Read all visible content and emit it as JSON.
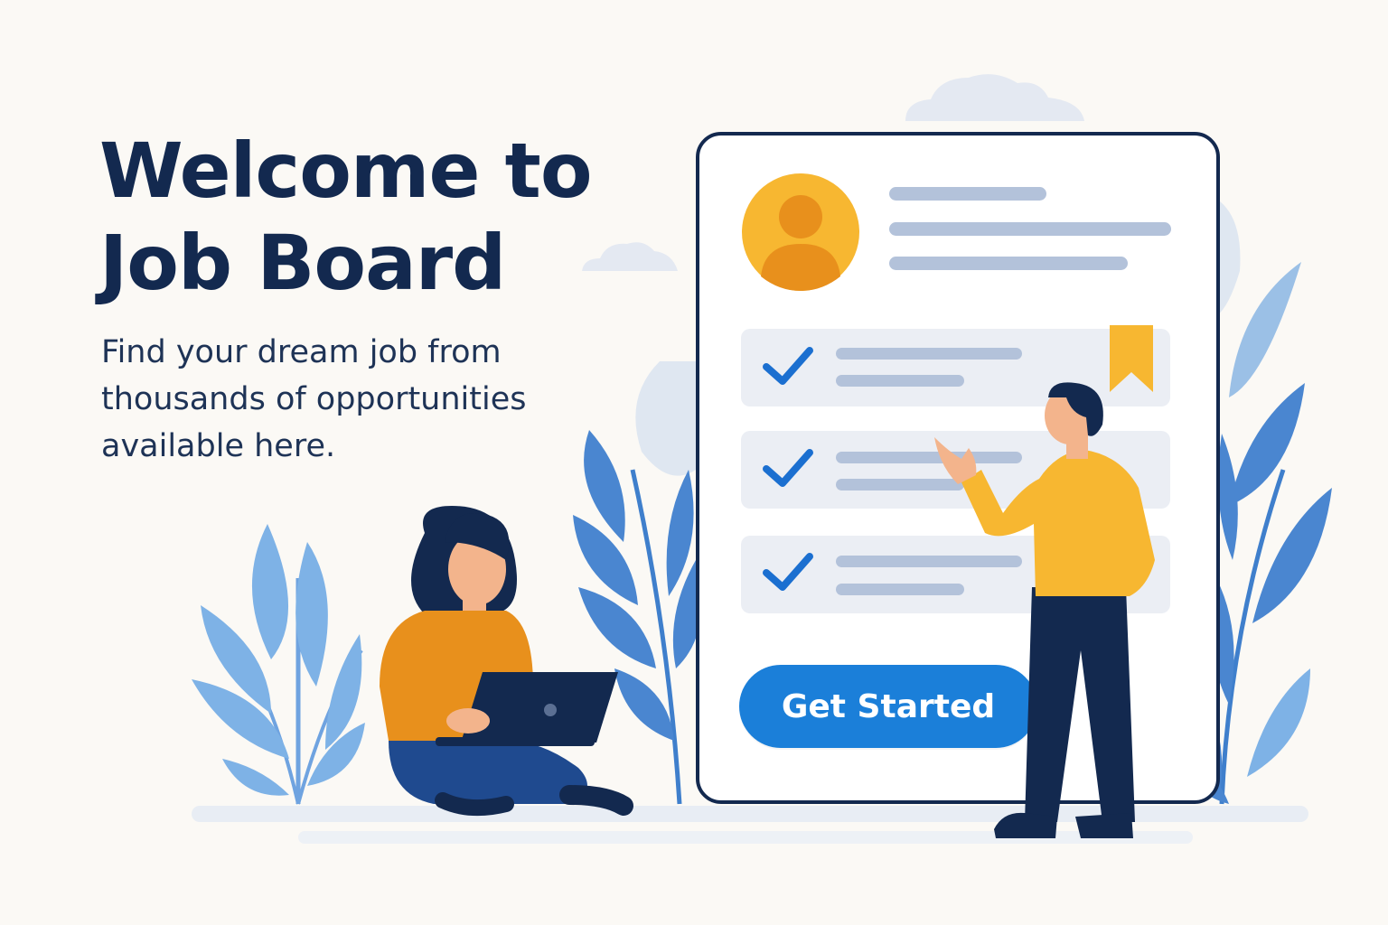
{
  "hero": {
    "title_line1": "Welcome to",
    "title_line2": "Job Board",
    "subtitle_line1": "Find your dream job from",
    "subtitle_line2": "thousands of opportunities",
    "subtitle_line3": "available here."
  },
  "card": {
    "cta_label": "Get Started",
    "job_items": [
      {
        "status": "checked"
      },
      {
        "status": "checked"
      },
      {
        "status": "checked"
      }
    ]
  },
  "icons": [
    "cloud-icon",
    "user-avatar-icon",
    "bookmark-icon",
    "checkmark-icon",
    "laptop-icon",
    "leaf-icon"
  ],
  "colors": {
    "background": "#fbf9f5",
    "heading": "#13294f",
    "accent_blue": "#1b7fd9",
    "accent_yellow": "#f7b731",
    "plant_blue": "#4a86d0",
    "placeholder_line": "#b3c2da"
  }
}
